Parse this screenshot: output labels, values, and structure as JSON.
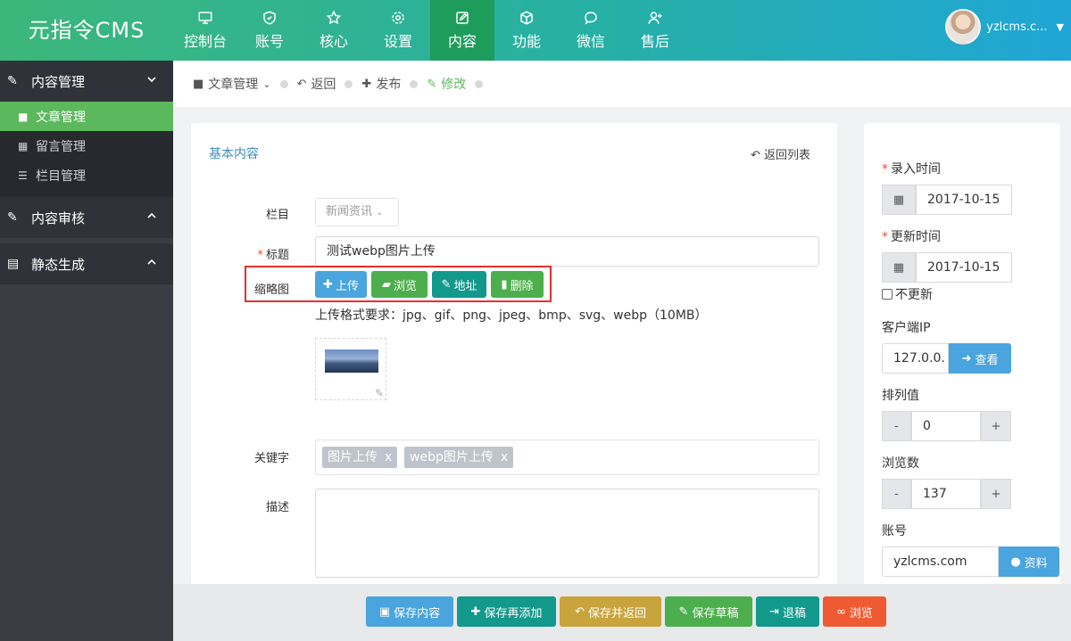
{
  "app": {
    "logo": "元指令CMS"
  },
  "topnav": [
    {
      "label": "控制台",
      "icon": "monitor-icon"
    },
    {
      "label": "账号",
      "icon": "shield-icon"
    },
    {
      "label": "核心",
      "icon": "star-icon"
    },
    {
      "label": "设置",
      "icon": "gear-icon"
    },
    {
      "label": "内容",
      "icon": "edit-icon",
      "active": true
    },
    {
      "label": "功能",
      "icon": "cube-icon"
    },
    {
      "label": "微信",
      "icon": "chat-icon"
    },
    {
      "label": "售后",
      "icon": "user-plus-icon"
    }
  ],
  "user": {
    "name": "yzlcms.c..."
  },
  "sidebar": {
    "groups": [
      {
        "label": "内容管理",
        "expanded": true,
        "items": [
          {
            "label": "文章管理",
            "active": true
          },
          {
            "label": "留言管理"
          },
          {
            "label": "栏目管理"
          }
        ]
      },
      {
        "label": "内容审核",
        "expanded": false
      },
      {
        "label": "静态生成",
        "expanded": false
      }
    ]
  },
  "breadcrumb": {
    "items": [
      "文章管理",
      "返回",
      "发布",
      "修改"
    ]
  },
  "form": {
    "section_title": "基本内容",
    "back_to_list": "返回列表",
    "column_label": "栏目",
    "column_value": "新闻资讯",
    "title_label": "标题",
    "title_value": "测试webp图片上传",
    "thumb_label": "缩略图",
    "thumb_buttons": {
      "upload": "上传",
      "browse": "浏览",
      "url": "地址",
      "delete": "删除"
    },
    "format_hint": "上传格式要求：jpg、gif、png、jpeg、bmp、svg、webp（10MB）",
    "keywords_label": "关键字",
    "keywords": [
      "图片上传",
      "webp图片上传"
    ],
    "tag_remove": "x",
    "description_label": "描述",
    "description_value": ""
  },
  "side_panel": {
    "required_mark": "*",
    "created_label": "录入时间",
    "created_value": "2017-10-15",
    "updated_label": "更新时间",
    "updated_value": "2017-10-15",
    "no_update_label": "不更新",
    "no_update_checked": false,
    "ip_label": "客户端IP",
    "ip_value": "127.0.0.",
    "ip_button": "查看",
    "sort_label": "排列值",
    "sort_value": "0",
    "views_label": "浏览数",
    "views_value": "137",
    "minus": "-",
    "plus": "+",
    "account_label": "账号",
    "account_value": "yzlcms.com",
    "account_button": "资料"
  },
  "footer_buttons": [
    {
      "label": "保存内容",
      "color": "#4aa4dd"
    },
    {
      "label": "保存再添加",
      "color": "#12998b"
    },
    {
      "label": "保存并返回",
      "color": "#c9a43c"
    },
    {
      "label": "保存草稿",
      "color": "#4cae4c"
    },
    {
      "label": "退稿",
      "color": "#12998b"
    },
    {
      "label": "浏览",
      "color": "#f05a33"
    }
  ],
  "colors": {
    "accent_green": "#5cb85c",
    "topbar_start": "#3cb77a",
    "topbar_end": "#1fa6d6",
    "highlight_red": "#e53030"
  }
}
